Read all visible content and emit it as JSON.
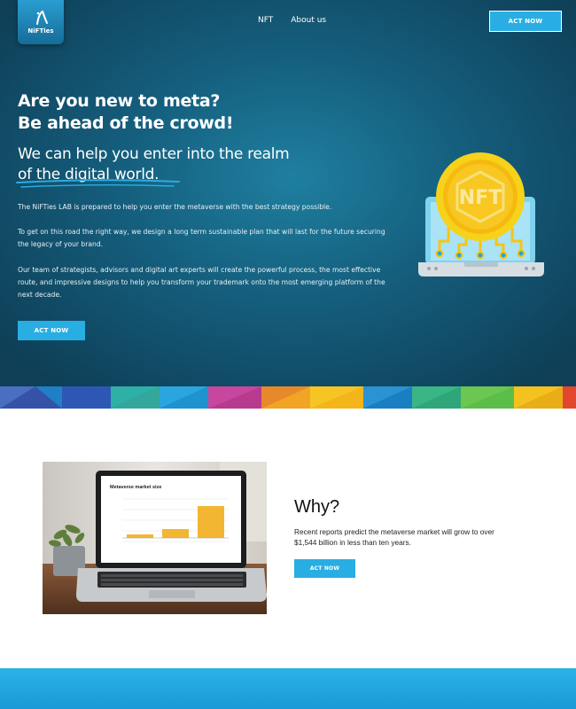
{
  "header": {
    "logo_text": "NiFTies",
    "nav": [
      {
        "label": "NFT"
      },
      {
        "label": "About us"
      }
    ],
    "cta_label": "ACT NOW"
  },
  "hero": {
    "title_line1": "Are you new to meta?",
    "title_line2": "Be ahead of the crowd!",
    "subtitle_line1": "We can help you enter into the realm",
    "subtitle_line2": "of the digital world.",
    "paragraphs": [
      "The NiFTies LAB is prepared to help you enter the metaverse with the best strategy possible.",
      "To get on this road the right way, we design a long term sustainable plan that will last for the future securing the legacy of your brand.",
      "Our team of strategists, advisors and digital art experts will create the powerful process, the most effective route, and impressive designs to help you transform your trademark onto the most emerging platform of the next decade."
    ],
    "cta_label": "ACT NOW",
    "illustration_text": "NFT",
    "illustration_icon": "nft-coin-laptop-icon"
  },
  "why": {
    "title": "Why?",
    "text": "Recent reports predict the metaverse market will grow to over $1,544 billion in less than ten years.",
    "cta_label": "ACT NOW",
    "screen_chart_title": "Metaverse market size"
  },
  "colors": {
    "accent": "#29aee3",
    "hero_dark": "#0e3f57",
    "coin_yellow": "#f7c514"
  }
}
